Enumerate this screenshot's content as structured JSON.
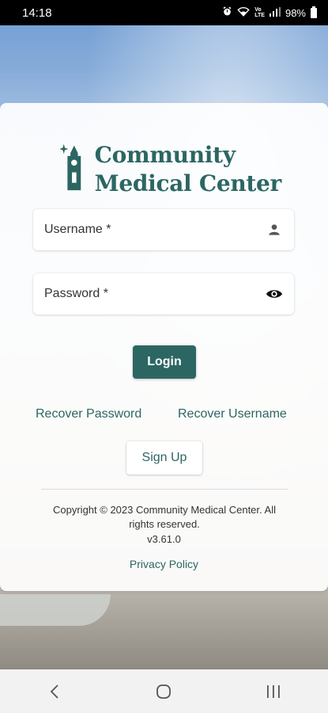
{
  "status_bar": {
    "time": "14:18",
    "battery": "98%",
    "icons": [
      "alarm-icon",
      "wifi-icon",
      "volte-icon",
      "signal-icon",
      "battery-icon"
    ]
  },
  "app": {
    "brand_line1": "Community",
    "brand_line2": "Medical Center",
    "brand_color": "#2c6663"
  },
  "form": {
    "username_label": "Username *",
    "username_icon": "person-icon",
    "password_label": "Password *",
    "password_icon": "eye-icon"
  },
  "actions": {
    "login_label": "Login",
    "recover_password_label": "Recover Password",
    "recover_username_label": "Recover Username",
    "signup_label": "Sign Up"
  },
  "footer": {
    "copyright": "Copyright © 2023 Community Medical Center. All rights reserved.",
    "version": "v3.61.0",
    "privacy_label": "Privacy Policy"
  },
  "nav_bar": {
    "items": [
      "back-icon",
      "home-icon",
      "recents-icon"
    ]
  }
}
